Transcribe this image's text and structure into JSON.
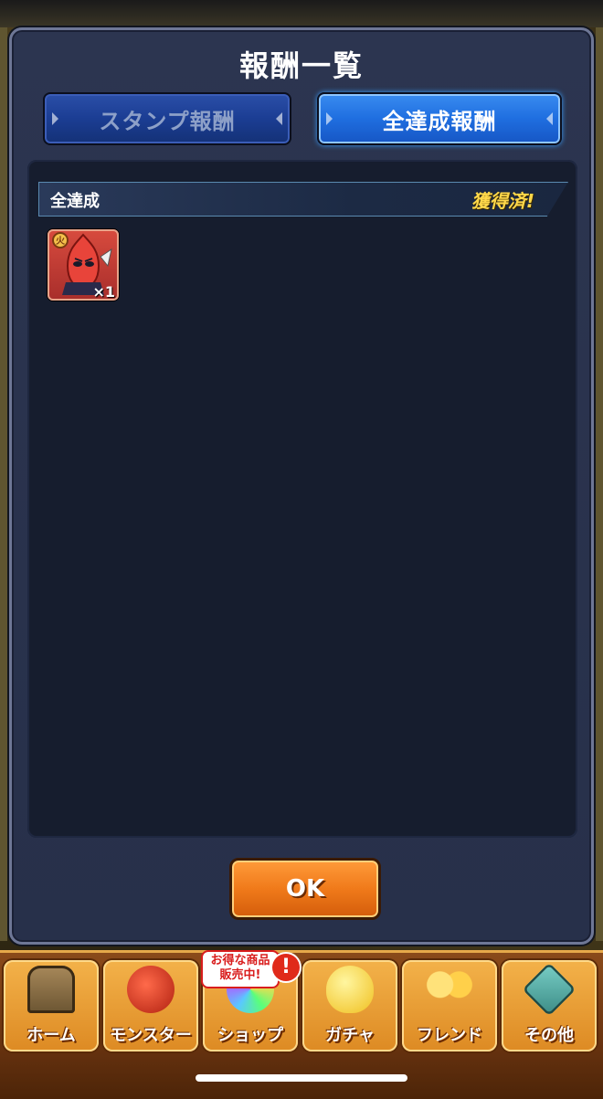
{
  "dialog": {
    "title": "報酬一覧",
    "tabs": [
      {
        "label": "スタンプ報酬",
        "selected": false
      },
      {
        "label": "全達成報酬",
        "selected": true
      }
    ],
    "section": {
      "label": "全達成",
      "status": "獲得済!"
    },
    "reward": {
      "icon": "red-monster-icon",
      "quantity": "×1"
    },
    "ok_label": "OK"
  },
  "nav": {
    "items": [
      {
        "label": "ホーム",
        "icon": "home-gate-icon"
      },
      {
        "label": "モンスター",
        "icon": "dragon-icon"
      },
      {
        "label": "ショップ",
        "icon": "rainbow-orb-icon"
      },
      {
        "label": "ガチャ",
        "icon": "egg-icon"
      },
      {
        "label": "フレンド",
        "icon": "friends-icon"
      },
      {
        "label": "その他",
        "icon": "question-sign-icon"
      }
    ],
    "shop_badge": "お得な商品 販売中!",
    "alert": "!"
  },
  "colors": {
    "tab_selected": "#1f6ee0",
    "tab_unselected": "#1b3d93",
    "status_gold": "#ffd84a",
    "ok_orange": "#f07a1a",
    "nav_orange": "#dd8a23"
  }
}
